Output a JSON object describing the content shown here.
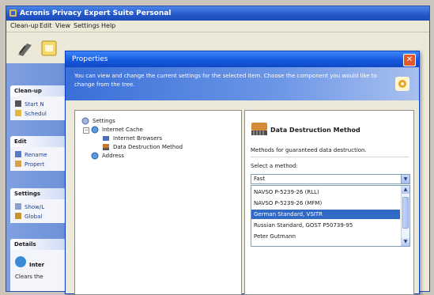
{
  "app": {
    "title": "Acronis Privacy Expert Suite Personal",
    "menu": [
      "Clean-up",
      "Edit",
      "View",
      "Settings",
      "Help"
    ]
  },
  "taskpane": {
    "groups": [
      {
        "title": "Clean-up",
        "items": [
          "Start N",
          "Schedul"
        ]
      },
      {
        "title": "Edit",
        "items": [
          "Rename",
          "Propert"
        ]
      },
      {
        "title": "Settings",
        "items": [
          "Show/L",
          "Global"
        ]
      },
      {
        "title": "Details",
        "items": [
          "Inter",
          "Clears the"
        ]
      }
    ]
  },
  "dialog": {
    "title": "Properties",
    "close_label": "✕",
    "description": "You can view and change the current settings for the selected item. Choose the component you would like to change from the tree.",
    "tree": {
      "root": "Settings",
      "cache": "Internet Cache",
      "children": [
        "Internet Browsers",
        "Data Destruction Method"
      ],
      "address": "Address"
    },
    "panel": {
      "title": "Data Destruction Method",
      "description": "Methods for guaranteed data destruction.",
      "select_label": "Select a method:",
      "current": "Fast",
      "options": [
        "NAVSO P-5239-26 (RLL)",
        "NAVSO P-5239-26 (MFM)",
        "German Standard, VSITR",
        "Russian Standard, GOST P50739-95",
        "Peter Gutmann"
      ],
      "selected_index": 2
    }
  }
}
